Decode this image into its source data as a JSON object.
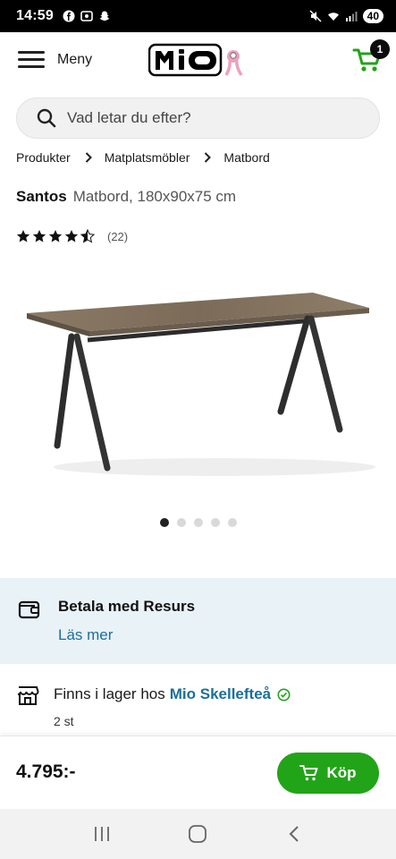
{
  "status_bar": {
    "time": "14:59",
    "battery": "40"
  },
  "header": {
    "menu_label": "Meny",
    "logo_text": "mio",
    "cart_count": "1"
  },
  "search": {
    "placeholder": "Vad letar du efter?"
  },
  "breadcrumb": [
    "Produkter",
    "Matplatsmöbler",
    "Matbord"
  ],
  "product": {
    "brand": "Santos",
    "description": "Matbord, 180x90x75 cm",
    "rating": 4.5,
    "review_count": "(22)",
    "image_count": 5,
    "active_image": 1
  },
  "payment": {
    "title": "Betala med Resurs",
    "link": "Läs mer"
  },
  "stock": {
    "text": "Finns i lager hos",
    "store": "Mio Skellefteå",
    "quantity": "2 st"
  },
  "buy": {
    "price": "4.795:-",
    "button_label": "Köp"
  },
  "colors": {
    "accent_green": "#22a418",
    "link_blue": "#1a6f9a",
    "banner_bg": "#e9f2f7"
  }
}
